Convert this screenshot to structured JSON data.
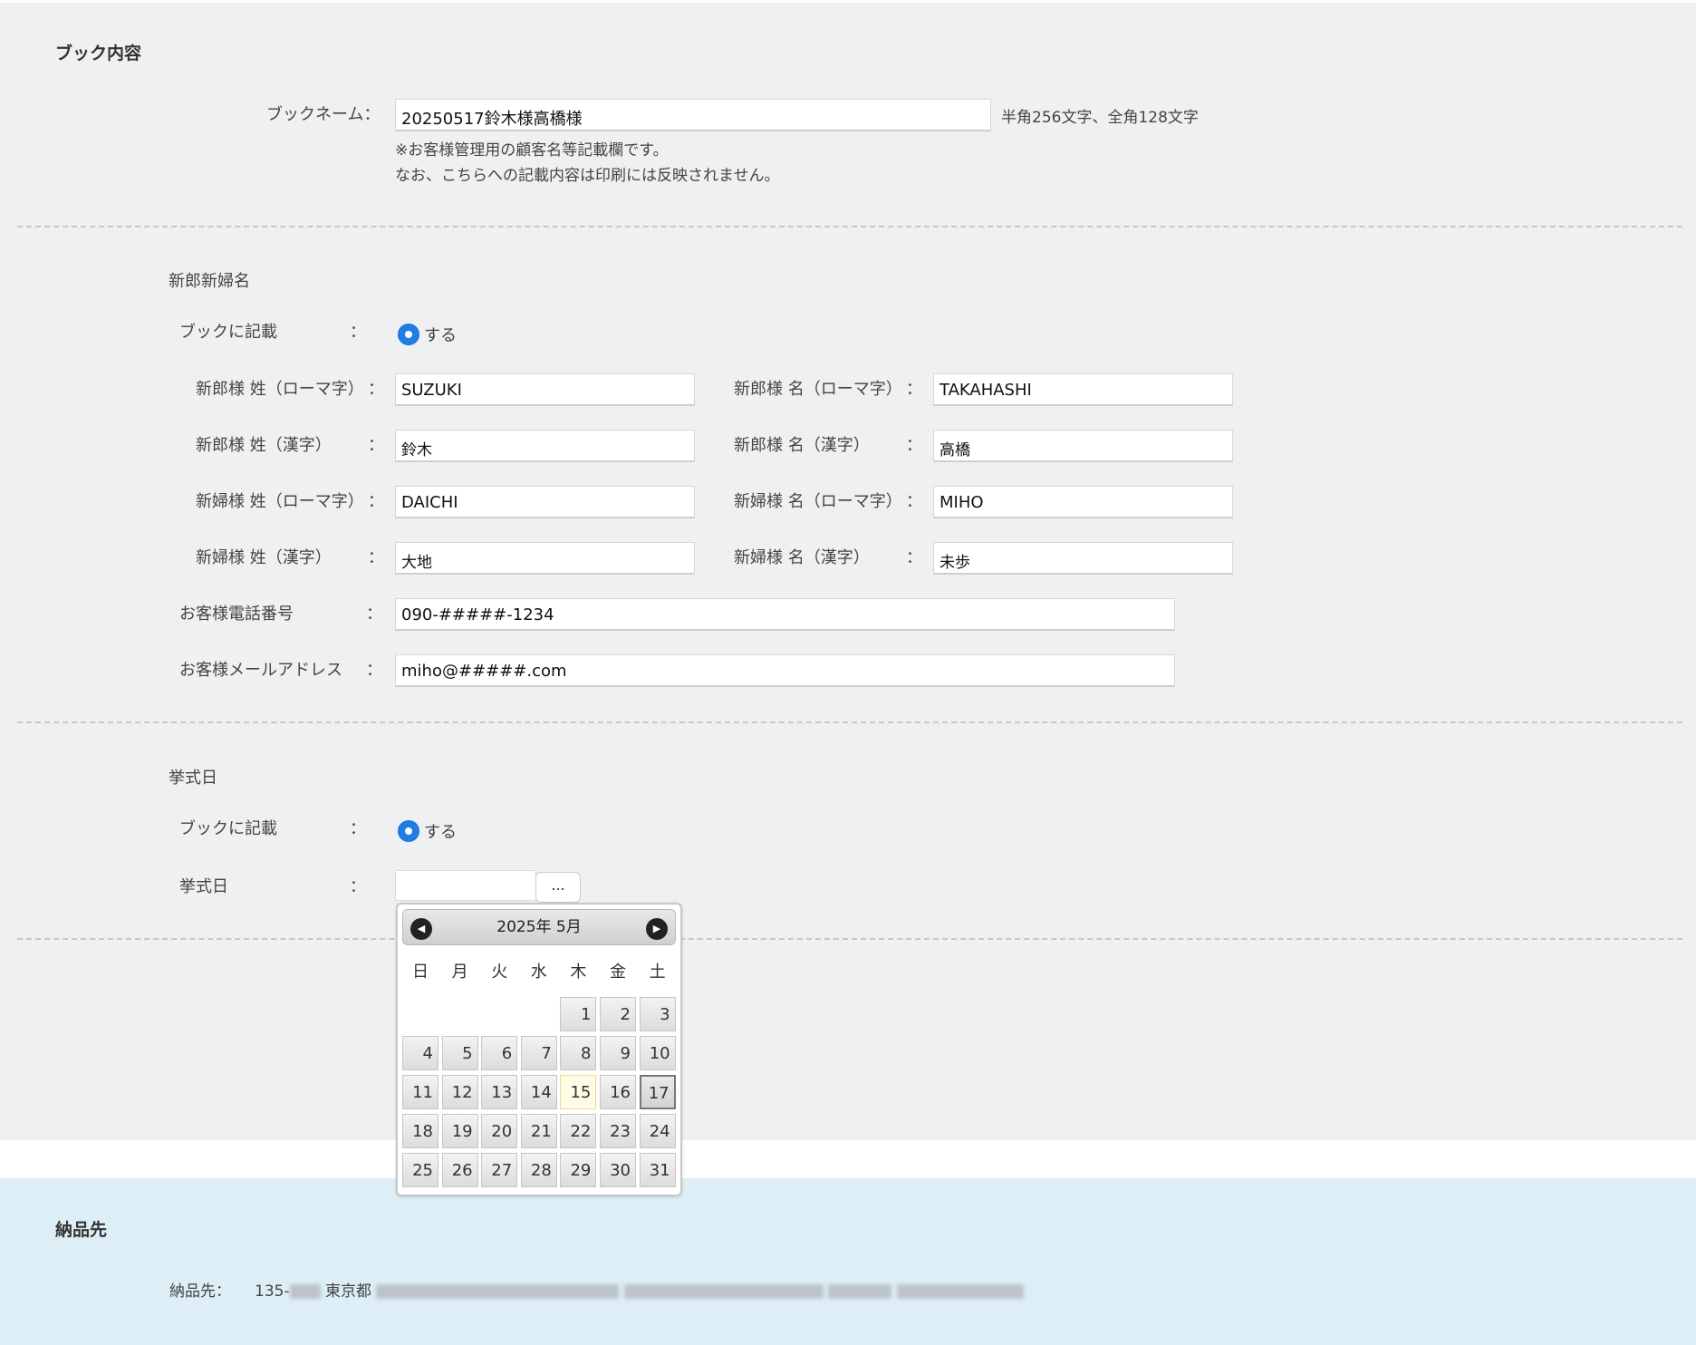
{
  "book_section": {
    "title": "ブック内容",
    "book_name_label": "ブックネーム：",
    "book_name_value": "20250517鈴木様高橋様",
    "book_name_hint": "半角256文字、全角128文字",
    "note_line1": "※お客様管理用の顧客名等記載欄です。",
    "note_line2": "なお、こちらへの記載内容は印刷には反映されません。"
  },
  "names_section": {
    "title": "新郎新婦名",
    "book_print_label": "ブックに記載",
    "radio_label": "する",
    "colon": "：",
    "fields": {
      "groom_last_roman": {
        "label": "新郎様 姓（ローマ字）",
        "value": "SUZUKI"
      },
      "groom_first_roman": {
        "label": "新郎様 名（ローマ字）",
        "value": "TAKAHASHI"
      },
      "groom_last_kanji": {
        "label": "新郎様 姓（漢字）",
        "value": "鈴木"
      },
      "groom_first_kanji": {
        "label": "新郎様 名（漢字）",
        "value": "高橋"
      },
      "bride_last_roman": {
        "label": "新婦様 姓（ローマ字）",
        "value": "DAICHI"
      },
      "bride_first_roman": {
        "label": "新婦様 名（ローマ字）",
        "value": "MIHO"
      },
      "bride_last_kanji": {
        "label": "新婦様 姓（漢字）",
        "value": "大地"
      },
      "bride_first_kanji": {
        "label": "新婦様 名（漢字）",
        "value": "未歩"
      },
      "phone": {
        "label": "お客様電話番号",
        "value": "090-#####-1234"
      },
      "email": {
        "label": "お客様メールアドレス",
        "value": "miho@#####.com"
      }
    }
  },
  "ceremony_section": {
    "title": "挙式日",
    "book_print_label": "ブックに記載",
    "radio_label": "する",
    "date_label": "挙式日",
    "date_value": "",
    "picker_button": "...",
    "calendar": {
      "month_label": "2025年 5月",
      "weekdays": [
        "日",
        "月",
        "火",
        "水",
        "木",
        "金",
        "土"
      ],
      "first_weekday_index": 4,
      "days_in_month": 31,
      "today": 15,
      "selected": 17
    }
  },
  "delivery_section": {
    "title": "納品先",
    "label": "納品先：",
    "address_visible": "135-",
    "city": "東京都"
  }
}
